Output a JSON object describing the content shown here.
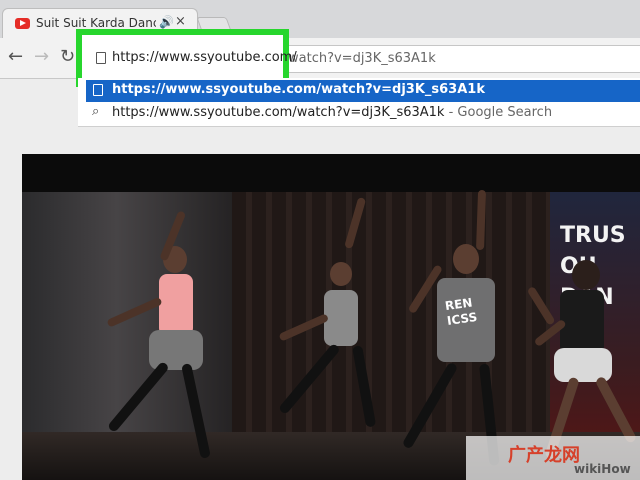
{
  "browser": {
    "tab_title": "Suit Suit Karda Danc",
    "tab_audio_icon": "audio-icon",
    "tab_close_label": "×",
    "url_highlight": "https://www.ssyoutube.com/",
    "url_rest": "watch?v=dj3K_s63A1k",
    "suggestion_1": "https://www.ssyoutube.com/watch?v=dj3K_s63A1k",
    "suggestion_2_main": "https://www.ssyoutube.com/watch?v=dj3K_s63A1k",
    "suggestion_2_suffix": " - Google Search",
    "highlight_color": "#27d62d"
  },
  "video": {
    "banner_lines": [
      "TRUS",
      "OU",
      "DAN"
    ],
    "shirt_text": "REN\nICSS"
  },
  "watermark": {
    "logo": "广产龙网",
    "suffix": "wikiHow"
  }
}
